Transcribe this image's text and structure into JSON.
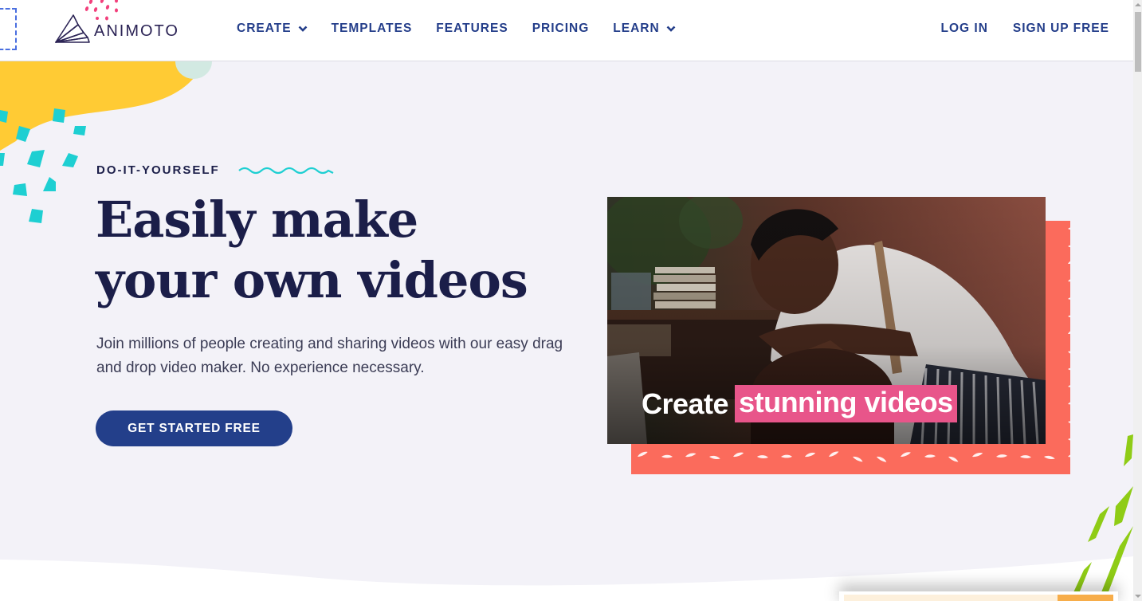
{
  "brand": {
    "name": "ANIMOTO",
    "colors": {
      "navy": "#1b1e49",
      "nav_blue": "#243e8a",
      "cta_blue": "#233f8a",
      "yellow": "#ffcb34",
      "teal": "#1ecfd2",
      "coral": "#fb6b5c",
      "pink_highlight": "#e8558a",
      "green": "#8fcc16",
      "background": "#f3f2f8"
    }
  },
  "nav": {
    "items": [
      {
        "label": "CREATE",
        "has_dropdown": true
      },
      {
        "label": "TEMPLATES",
        "has_dropdown": false
      },
      {
        "label": "FEATURES",
        "has_dropdown": false
      },
      {
        "label": "PRICING",
        "has_dropdown": false
      },
      {
        "label": "LEARN",
        "has_dropdown": true
      }
    ],
    "login_label": "LOG IN",
    "signup_label": "SIGN UP FREE"
  },
  "hero": {
    "eyebrow": "DO-IT-YOURSELF",
    "headline": "Easily make your own videos",
    "subtext": "Join millions of people creating and sharing videos with our easy drag and drop video maker. No experience necessary.",
    "cta_label": "GET STARTED FREE"
  },
  "media": {
    "caption_plain": "Create",
    "caption_highlight": "stunning videos",
    "icon": "video-preview"
  }
}
